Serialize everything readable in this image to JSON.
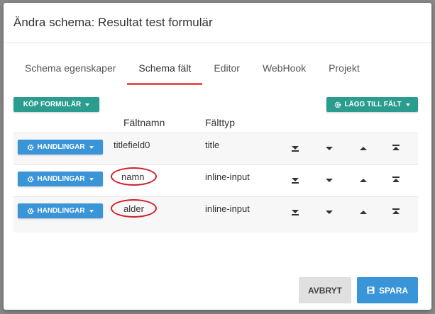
{
  "modal": {
    "title": "Ändra schema: Resultat test formulär"
  },
  "tabs": [
    {
      "label": "Schema egenskaper",
      "active": false
    },
    {
      "label": "Schema fält",
      "active": true
    },
    {
      "label": "Editor",
      "active": false
    },
    {
      "label": "WebHook",
      "active": false
    },
    {
      "label": "Projekt",
      "active": false
    }
  ],
  "toolbar": {
    "buy_form_label": "KÖP FORMULÄR",
    "add_field_label": "LÄGG TILL FÄLT"
  },
  "table": {
    "headers": {
      "name": "Fältnamn",
      "type": "Fälttyp"
    },
    "action_label": "HANDLINGAR",
    "rows": [
      {
        "name": "titlefield0",
        "type": "title",
        "highlighted": false
      },
      {
        "name": "namn",
        "type": "inline-input",
        "highlighted": true
      },
      {
        "name": "alder",
        "type": "inline-input",
        "highlighted": true
      }
    ]
  },
  "footer": {
    "cancel_label": "AVBRYT",
    "save_label": "SPARA"
  },
  "colors": {
    "teal": "#2a9d8f",
    "blue": "#3a95d8",
    "tab_underline": "#e8545c",
    "highlight_ring": "#d0202a",
    "cancel_bg": "#e0e0e0"
  },
  "icons": [
    "gear-icon",
    "move-bottom-icon",
    "move-down-icon",
    "move-up-icon",
    "move-top-icon",
    "save-icon"
  ]
}
